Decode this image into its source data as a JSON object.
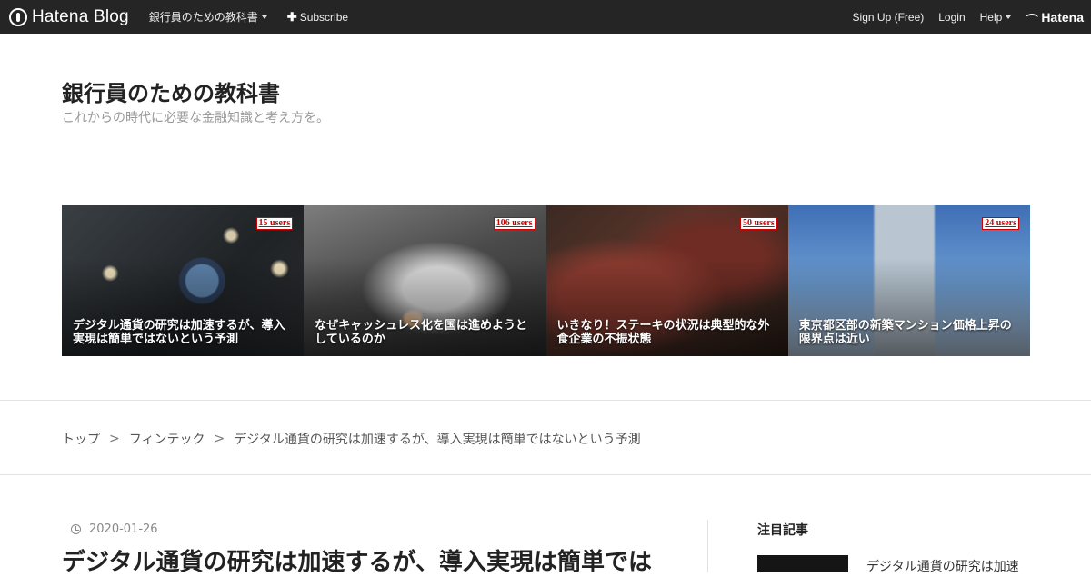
{
  "topbar": {
    "logo_text": "Hatena Blog",
    "blog_menu_label": "銀行員のための教科書",
    "subscribe_label": "Subscribe",
    "signup_label": "Sign Up (Free)",
    "login_label": "Login",
    "help_label": "Help",
    "brand_label": "Hatena"
  },
  "blog": {
    "title": "銀行員のための教科書",
    "description": "これからの時代に必要な金融知識と考え方を。"
  },
  "featured": [
    {
      "users": "15 users",
      "title": "デジタル通貨の研究は加速するが、導入実現は簡単ではないという予測"
    },
    {
      "users": "106 users",
      "title": "なぜキャッシュレス化を国は進めようとしているのか"
    },
    {
      "users": "50 users",
      "title": "いきなり！ステーキの状況は典型的な外食企業の不振状態"
    },
    {
      "users": "24 users",
      "title": "東京都区部の新築マンション価格上昇の限界点は近い"
    }
  ],
  "breadcrumb": {
    "items": [
      "トップ",
      "フィンテック",
      "デジタル通貨の研究は加速するが、導入実現は簡単ではないという予測"
    ],
    "separator": ">"
  },
  "entry": {
    "date": "2020-01-26",
    "title": "デジタル通貨の研究は加速するが、導入実現は簡単では"
  },
  "sidebar": {
    "heading": "注目記事",
    "items": [
      {
        "title": "デジタル通貨の研究は加速"
      }
    ]
  }
}
